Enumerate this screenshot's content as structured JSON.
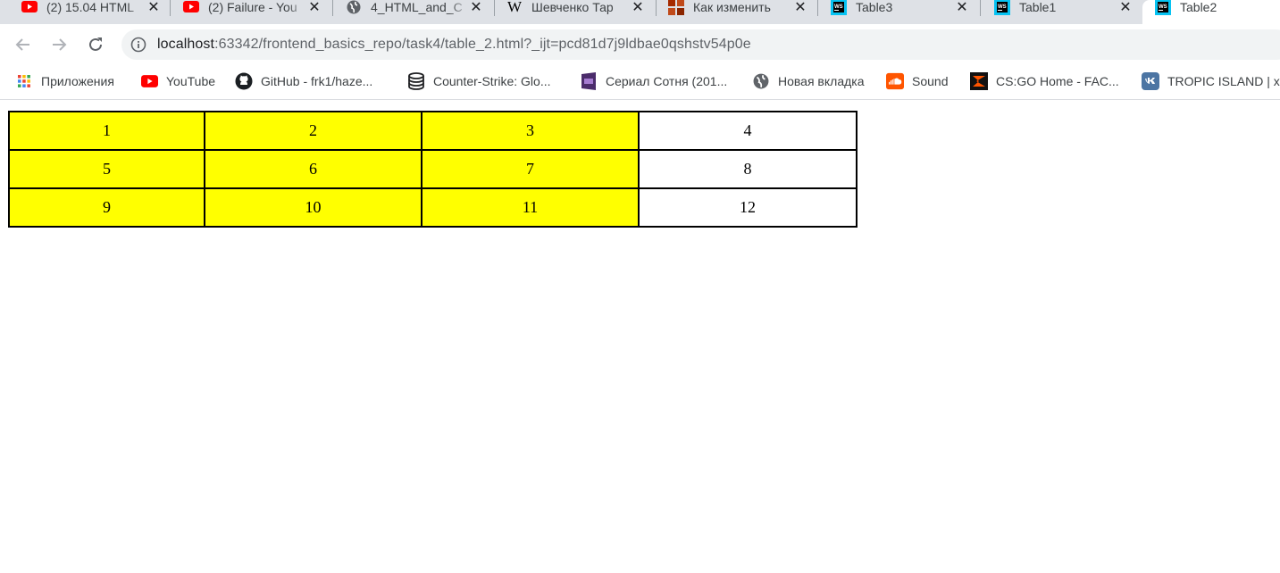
{
  "tabs": [
    {
      "title": "(2) 15.04 HTML",
      "icon": "youtube-icon"
    },
    {
      "title": "(2) Failure - You",
      "icon": "youtube-icon"
    },
    {
      "title": "4_HTML_and_C",
      "icon": "globe-icon"
    },
    {
      "title": "Шевченко Тар",
      "icon": "wikipedia-icon"
    },
    {
      "title": "Как изменить",
      "icon": "site-icon"
    },
    {
      "title": "Table3",
      "icon": "webstorm-icon"
    },
    {
      "title": "Table1",
      "icon": "webstorm-icon"
    },
    {
      "title": "Table2",
      "icon": "webstorm-icon",
      "active": true
    }
  ],
  "address_bar": {
    "host": "localhost",
    "rest": ":63342/frontend_basics_repo/task4/table_2.html?_ijt=pcd81d7j9ldbae0qshstv54p0e"
  },
  "bookmarks": [
    {
      "label": "Приложения",
      "icon": "apps-grid-icon"
    },
    {
      "label": "YouTube",
      "icon": "youtube-icon"
    },
    {
      "label": "GitHub - frk1/haze...",
      "icon": "github-icon"
    },
    {
      "label": "Counter-Strike: Glo...",
      "icon": "database-icon"
    },
    {
      "label": "Сериал Сотня (201...",
      "icon": "tv-icon"
    },
    {
      "label": "Новая вкладка",
      "icon": "globe-icon"
    },
    {
      "label": "Sound",
      "icon": "soundcloud-icon"
    },
    {
      "label": "CS:GO Home - FAC...",
      "icon": "faceit-icon"
    },
    {
      "label": "TROPIC ISLAND | x",
      "icon": "vk-icon"
    }
  ],
  "table": {
    "rows": [
      [
        "1",
        "2",
        "3",
        "4"
      ],
      [
        "5",
        "6",
        "7",
        "8"
      ],
      [
        "9",
        "10",
        "11",
        "12"
      ]
    ],
    "highlight_color": "#ffff00"
  }
}
